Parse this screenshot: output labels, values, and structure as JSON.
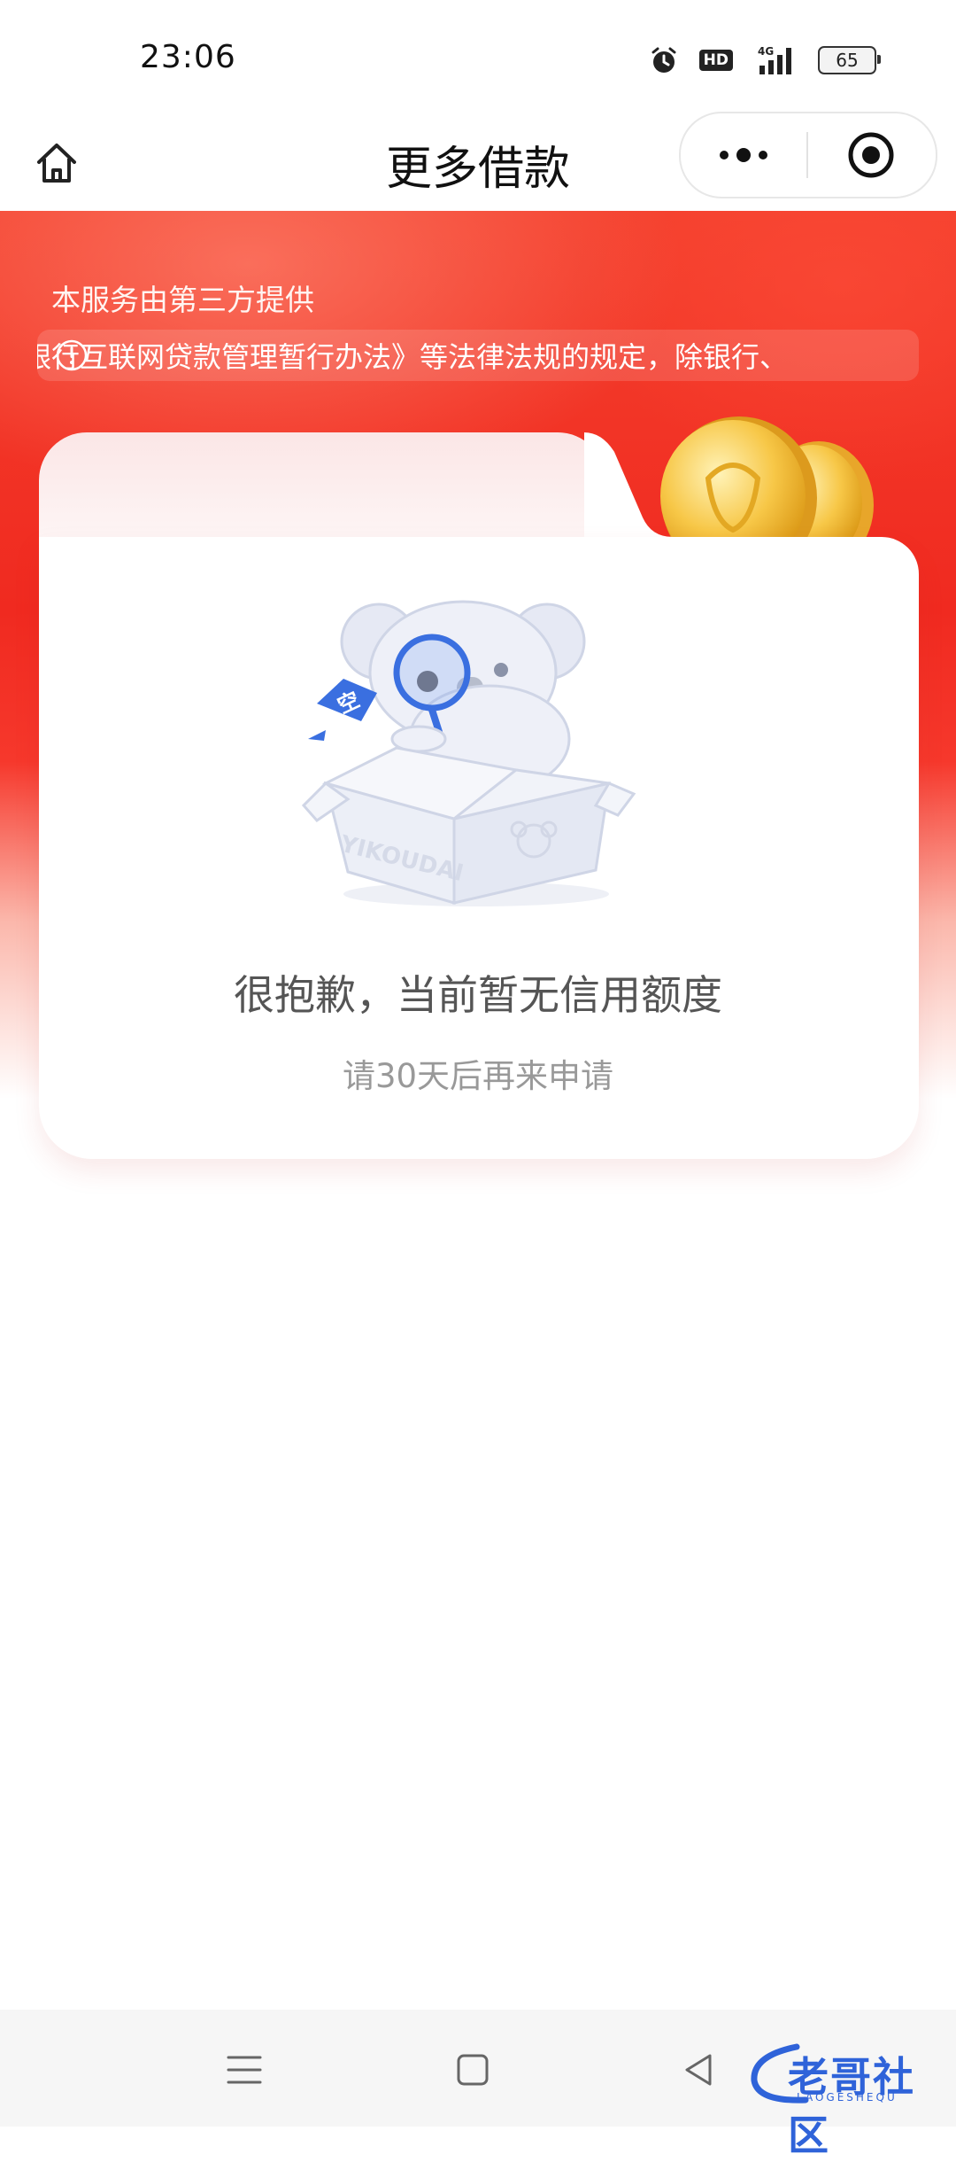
{
  "status_bar": {
    "time": "23:06",
    "hd_label": "HD",
    "network_label": "4G",
    "battery_level": "65"
  },
  "nav": {
    "title": "更多借款",
    "icons": [
      "home-icon",
      "more-dots-icon",
      "close-circle-icon"
    ]
  },
  "banner": {
    "disclaimer": "本服务由第三方提供",
    "notice": "《商业银行互联网贷款管理暂行办法》等法律法规的规定，除银行、"
  },
  "empty_state": {
    "box_brand": "YIKOUDAI",
    "speech_tag": "空",
    "title": "很抱歉，当前暂无信用额度",
    "subtitle": "请30天后再来申请"
  },
  "system_nav": {
    "icons": [
      "menu-icon",
      "home-square-icon",
      "back-icon"
    ]
  },
  "watermark": {
    "text": "老哥社区",
    "sub": "LAOGESHEQU"
  },
  "colors": {
    "banner_red": "#f02a20",
    "title_gray": "#555555",
    "subtitle_gray": "#999999",
    "illustration_blue": "#3a6fe0"
  }
}
